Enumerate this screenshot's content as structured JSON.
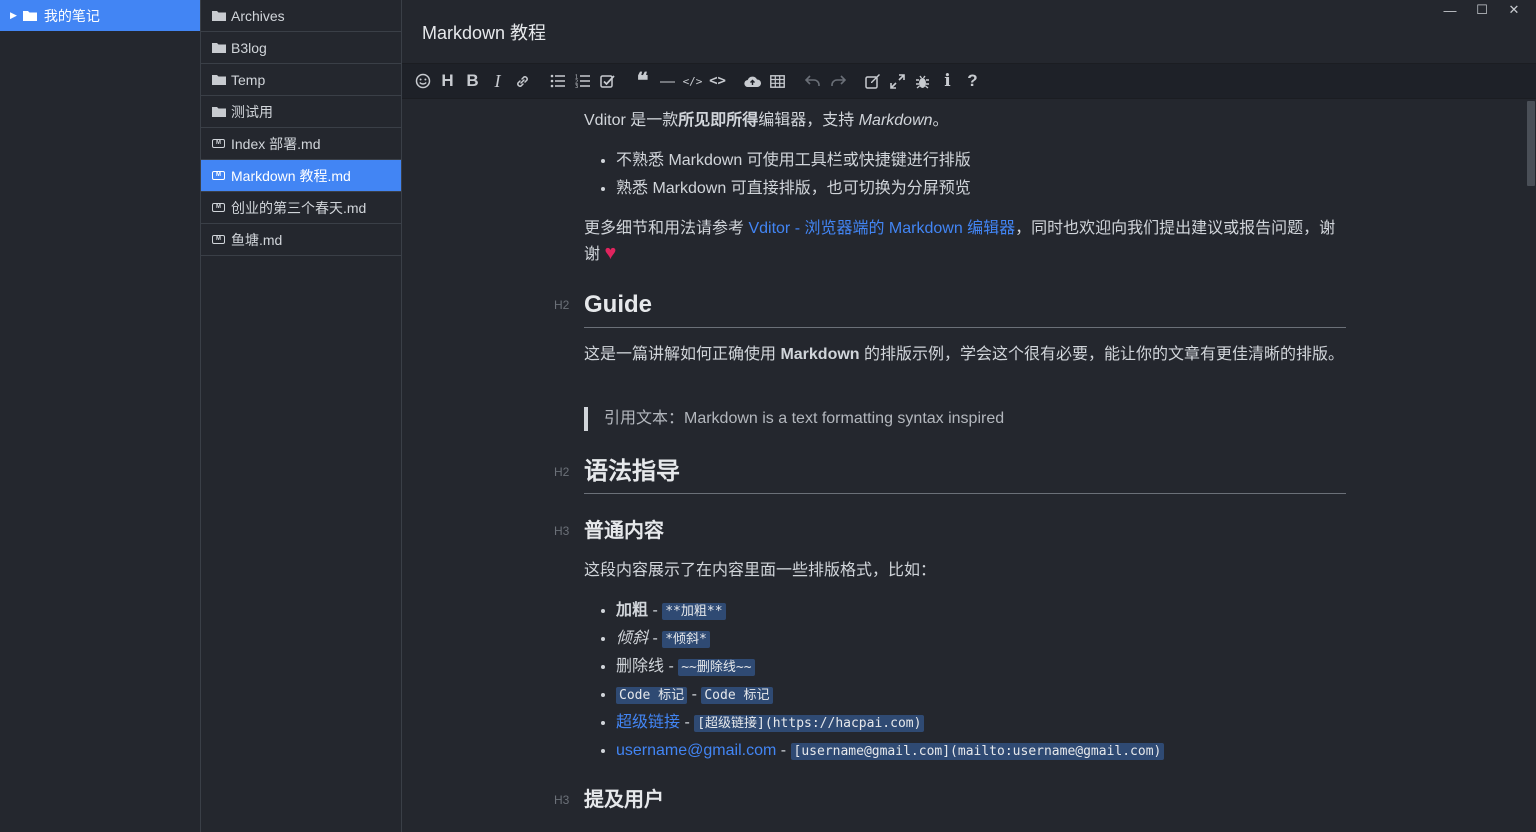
{
  "notebooks": [
    {
      "label": "我的笔记"
    }
  ],
  "tree": [
    {
      "label": "Archives",
      "type": "folder"
    },
    {
      "label": "B3log",
      "type": "folder"
    },
    {
      "label": "Temp",
      "type": "folder"
    },
    {
      "label": "测试用",
      "type": "folder"
    },
    {
      "label": "Index 部署.md",
      "type": "file"
    },
    {
      "label": "Markdown 教程.md",
      "type": "file",
      "active": true
    },
    {
      "label": "创业的第三个春天.md",
      "type": "file"
    },
    {
      "label": "鱼塘.md",
      "type": "file"
    }
  ],
  "window_controls": {
    "minimize": "—",
    "maximize": "☐",
    "close": "✕"
  },
  "editor": {
    "title": "Markdown 教程"
  },
  "toolbar": {
    "icons": [
      "emoji-icon",
      "heading-icon",
      "bold-icon",
      "italic-icon",
      "link-icon",
      "list-icon",
      "ordered-list-icon",
      "check-icon",
      "quote-icon",
      "line-icon",
      "inline-code-icon",
      "code-icon",
      "upload-icon",
      "table-icon",
      "undo-icon",
      "redo-icon",
      "edit-mode-icon",
      "fullscreen-icon",
      "debug-icon",
      "info-icon",
      "help-icon"
    ]
  },
  "doc": {
    "intro_prefix": "Vditor 是一款",
    "intro_bold": "所见即所得",
    "intro_mid": "编辑器，支持 ",
    "intro_em": "Markdown",
    "intro_end": "。",
    "bullets1": [
      "不熟悉 Markdown 可使用工具栏或快捷键进行排版",
      "熟悉 Markdown 可直接排版，也可切换为分屏预览"
    ],
    "more_prefix": "更多细节和用法请参考 ",
    "more_link": "Vditor - 浏览器端的 Markdown 编辑器",
    "more_suffix": "，同时也欢迎向我们提出建议或报告问题，谢谢 ",
    "heart": "♥",
    "h2_guide_label": "H2",
    "h2_guide": "Guide",
    "guide_prefix": "这是一篇讲解如何正确使用 ",
    "guide_bold": "Markdown",
    "guide_suffix": " 的排版示例，学会这个很有必要，能让你的文章有更佳清晰的排版。",
    "quote": "引用文本：Markdown is a text formatting syntax inspired",
    "h2_syntax_label": "H2",
    "h2_syntax": "语法指导",
    "h3_normal_label": "H3",
    "h3_normal": "普通内容",
    "normal_desc": "这段内容展示了在内容里面一些排版格式，比如：",
    "items": [
      {
        "text": "加粗",
        "sep": " - ",
        "code": "**加粗**"
      },
      {
        "text": "倾斜",
        "sep": " - ",
        "code": "*倾斜*"
      },
      {
        "text": "删除线",
        "sep": " - ",
        "code": "~~删除线~~"
      },
      {
        "text": "Code 标记",
        "sep": " - ",
        "code": "Code 标记"
      },
      {
        "text": "超级链接",
        "sep": " - ",
        "code": "[超级链接](https://hacpai.com)"
      },
      {
        "text": "username@gmail.com",
        "sep": " - ",
        "code": "[username@gmail.com](mailto:username@gmail.com)"
      }
    ],
    "h3_mention_label": "H3",
    "h3_mention": "提及用户"
  }
}
